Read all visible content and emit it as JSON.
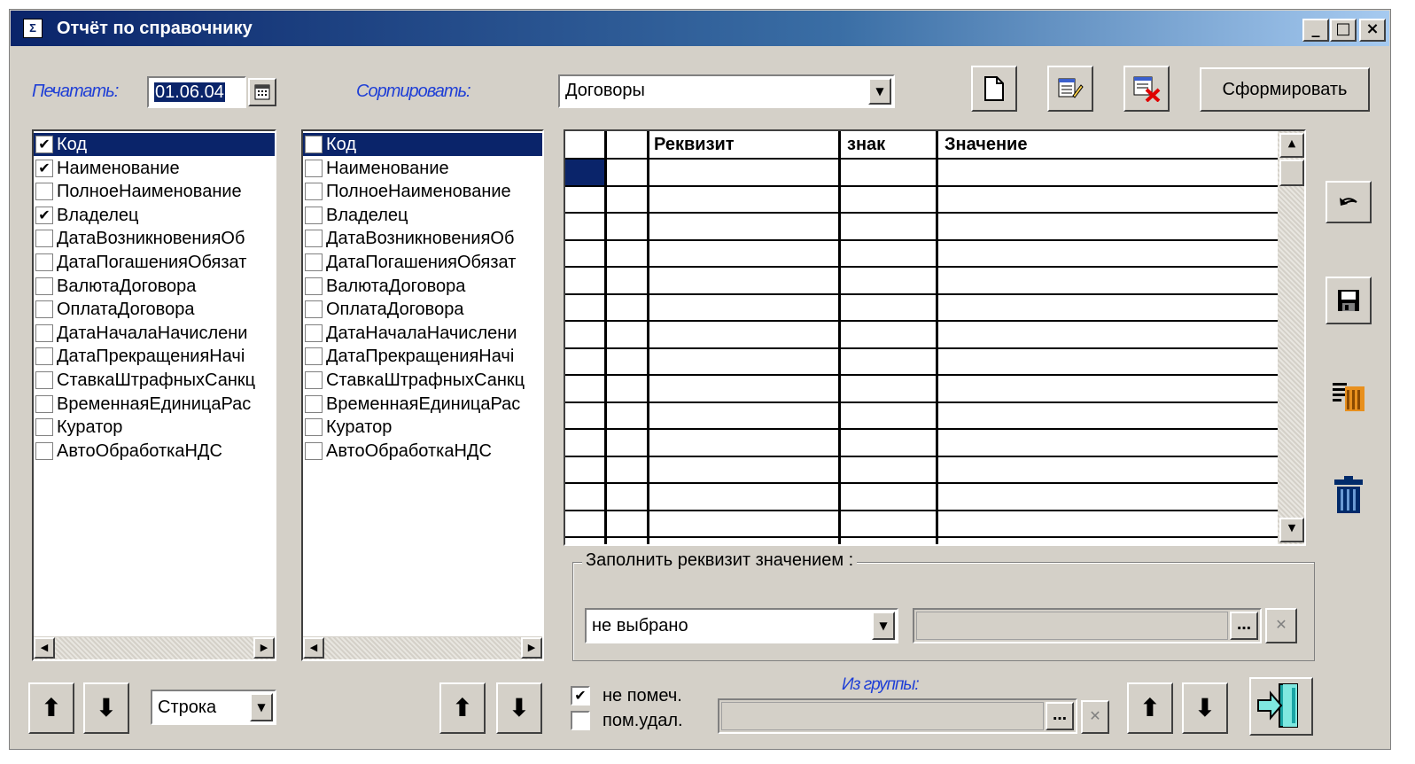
{
  "window": {
    "icon": "report-icon",
    "title": "Отчёт по справочнику",
    "controls": {
      "minimize": "_",
      "maximize": "□",
      "close": "×"
    }
  },
  "print": {
    "label": "Печатать:",
    "date_value": "01.06.04"
  },
  "sort": {
    "label": "Сортировать:",
    "selected": "Договоры"
  },
  "toolbar": {
    "generate_label": "Сформировать"
  },
  "left_list": {
    "items": [
      {
        "label": "Код",
        "checked": true,
        "selected": true
      },
      {
        "label": "Наименование",
        "checked": true
      },
      {
        "label": "ПолноеНаименование",
        "checked": false
      },
      {
        "label": "Владелец",
        "checked": true
      },
      {
        "label": "ДатаВозникновенияОб",
        "checked": false
      },
      {
        "label": "ДатаПогашенияОбязат",
        "checked": false
      },
      {
        "label": "ВалютаДоговора",
        "checked": false
      },
      {
        "label": "ОплатаДоговора",
        "checked": false
      },
      {
        "label": "ДатаНачалаНачислени",
        "checked": false
      },
      {
        "label": "ДатаПрекращенияНачі",
        "checked": false
      },
      {
        "label": "СтавкаШтрафныхСанкц",
        "checked": false
      },
      {
        "label": "ВременнаяЕдиницаРас",
        "checked": false
      },
      {
        "label": "Куратор",
        "checked": false
      },
      {
        "label": "АвтоОбработкаНДС",
        "checked": false
      }
    ]
  },
  "right_list": {
    "items": [
      {
        "label": "Код",
        "checked": false,
        "selected": true
      },
      {
        "label": "Наименование",
        "checked": false
      },
      {
        "label": "ПолноеНаименование",
        "checked": false
      },
      {
        "label": "Владелец",
        "checked": false
      },
      {
        "label": "ДатаВозникновенияОб",
        "checked": false
      },
      {
        "label": "ДатаПогашенияОбязат",
        "checked": false
      },
      {
        "label": "ВалютаДоговора",
        "checked": false
      },
      {
        "label": "ОплатаДоговора",
        "checked": false
      },
      {
        "label": "ДатаНачалаНачислени",
        "checked": false
      },
      {
        "label": "ДатаПрекращенияНачі",
        "checked": false
      },
      {
        "label": "СтавкаШтрафныхСанкц",
        "checked": false
      },
      {
        "label": "ВременнаяЕдиницаРас",
        "checked": false
      },
      {
        "label": "Куратор",
        "checked": false
      },
      {
        "label": "АвтоОбработкаНДС",
        "checked": false
      }
    ]
  },
  "grid": {
    "columns": [
      "",
      "",
      "Реквизит",
      "знак",
      "Значение"
    ],
    "empty_rows": 14
  },
  "fill_group": {
    "title": "Заполнить реквизит значением :",
    "combo_value": "не выбрано"
  },
  "row_combo": {
    "value": "Строка"
  },
  "filters": {
    "not_marked": {
      "label": "не помеч.",
      "checked": true
    },
    "marked_deleted": {
      "label": "пом.удал.",
      "checked": false
    }
  },
  "from_group": {
    "label": "Из группы:"
  },
  "icons": {
    "calendar": "calendar-icon",
    "new": "new-document-icon",
    "edit": "edit-list-icon",
    "delete_list": "delete-list-icon",
    "undo": "undo-icon",
    "save": "save-icon",
    "table_edit": "table-edit-icon",
    "trash": "trash-icon",
    "exit": "exit-icon",
    "up": "arrow-up-icon",
    "down": "arrow-down-icon",
    "ellipsis": "ellipsis-icon",
    "clear": "clear-icon"
  },
  "colors": {
    "title_bar": "#0a246a",
    "face": "#d4d0c8",
    "selection": "#0a246a",
    "italic_label": "#1f3fd6"
  }
}
